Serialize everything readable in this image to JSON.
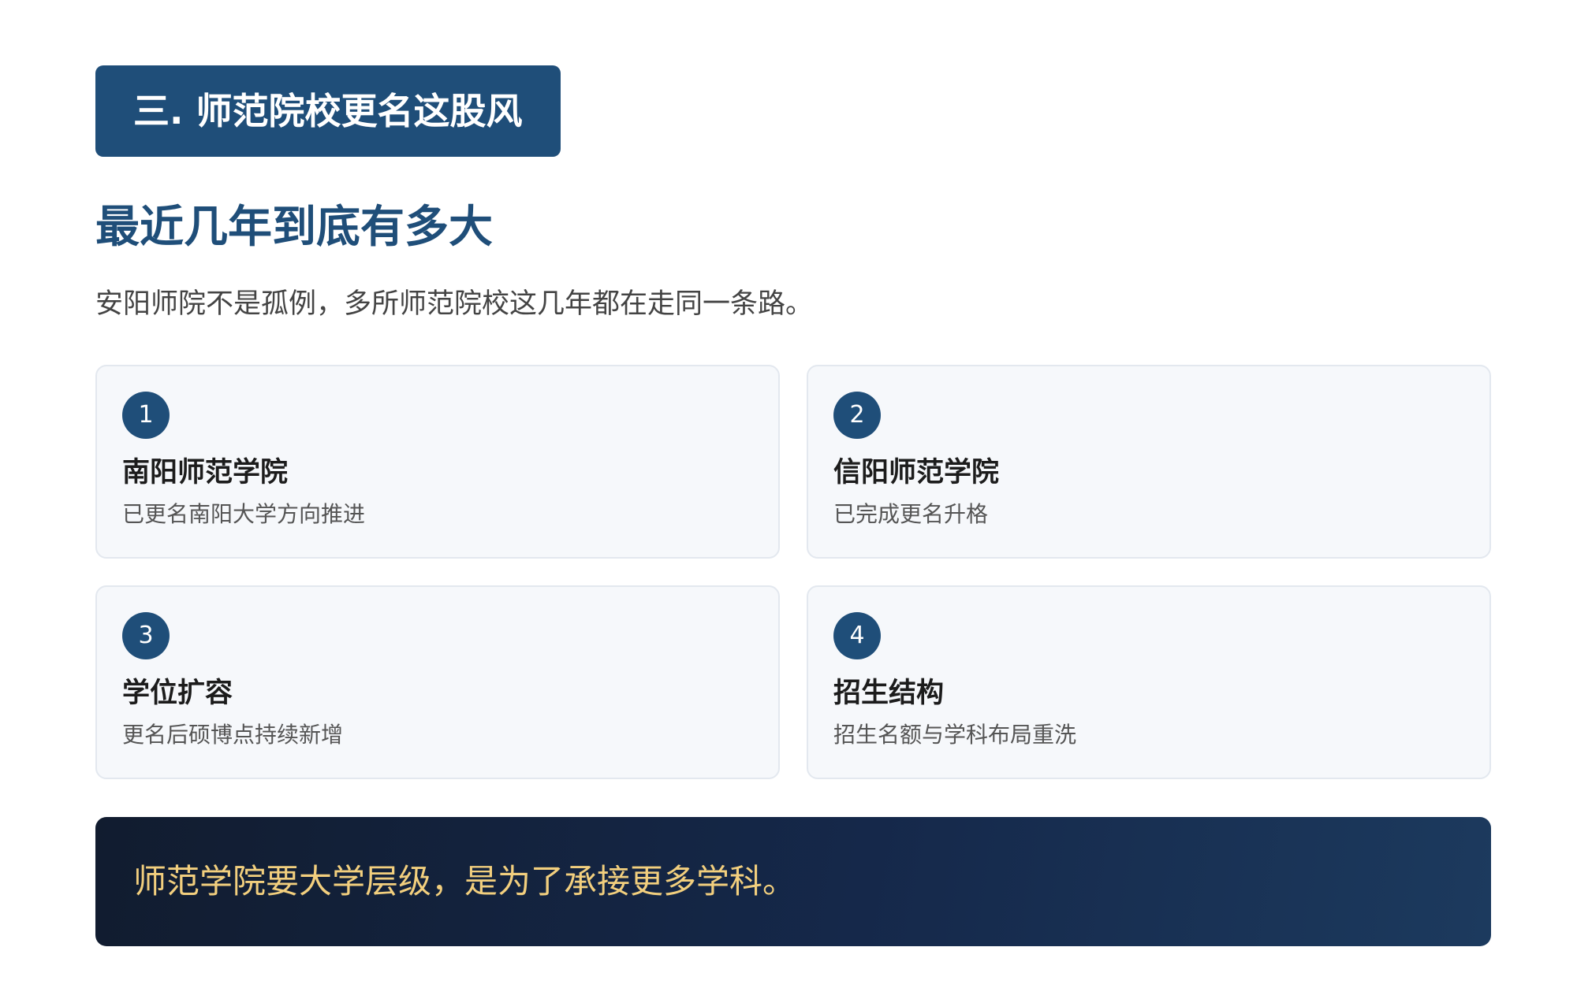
{
  "section": {
    "badge": "三. 师范院校更名这股风"
  },
  "heading": "最近几年到底有多大",
  "intro": "安阳师院不是孤例，多所师范院校这几年都在走同一条路。",
  "cards": [
    {
      "number": "1",
      "title": "南阳师范学院",
      "desc": "已更名南阳大学方向推进"
    },
    {
      "number": "2",
      "title": "信阳师范学院",
      "desc": "已完成更名升格"
    },
    {
      "number": "3",
      "title": "学位扩容",
      "desc": "更名后硕博点持续新增"
    },
    {
      "number": "4",
      "title": "招生结构",
      "desc": "招生名额与学科布局重洗"
    }
  ],
  "callout": "师范学院要大学层级，是为了承接更多学科。",
  "colors": {
    "primary": "#1f4e79",
    "card_bg": "#f6f8fb",
    "card_border": "#e3e8ef",
    "callout_bg": "#13233f",
    "callout_text": "#f2cf7e"
  }
}
